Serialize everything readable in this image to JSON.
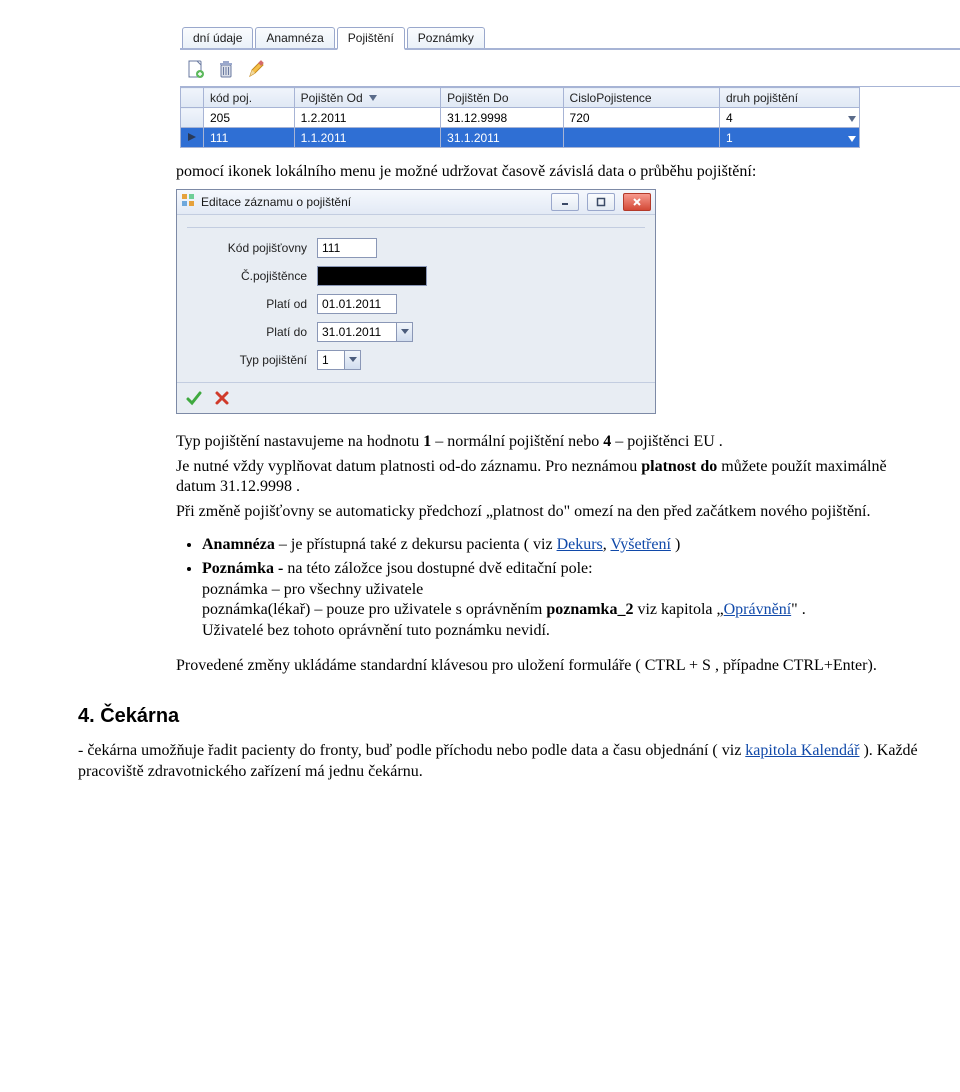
{
  "tabs": {
    "items": [
      "dní údaje",
      "Anamnéza",
      "Pojištění",
      "Poznámky"
    ],
    "active": 2
  },
  "toolbar_icons": [
    "new",
    "delete",
    "edit"
  ],
  "grid": {
    "headers": [
      "kód poj.",
      "Pojištěn Od",
      "Pojištěn Do",
      "CisloPojistence",
      "druh pojištění"
    ],
    "rows": [
      {
        "kod": "205",
        "od": "1.2.2011",
        "do": "31.12.9998",
        "cislo": "720",
        "druh": "4",
        "selected": false
      },
      {
        "kod": "111",
        "od": "1.1.2011",
        "do": "31.1.2011",
        "cislo": "",
        "druh": "1",
        "selected": true
      }
    ]
  },
  "para_intro": "pomocí ikonek lokálního menu je možné udržovat časově závislá data o průběhu pojištění:",
  "dialog": {
    "title": "Editace záznamu o pojištění",
    "fields": {
      "kod_label": "Kód pojišťovny",
      "kod_value": "111",
      "cislo_label": "Č.pojištěnce",
      "cislo_value": "",
      "od_label": "Platí od",
      "od_value": "01.01.2011",
      "do_label": "Platí do",
      "do_value": "31.01.2011",
      "typ_label": "Typ pojištění",
      "typ_value": "1"
    }
  },
  "after_dialog": {
    "p1a": "Typ pojištění nastavujeme na hodnotu ",
    "p1b": "1",
    "p1c": " – normální pojištění nebo ",
    "p1d": "4",
    "p1e": " – pojištěnci EU .",
    "p2a": "Je nutné vždy vyplňovat datum platnosti od-do záznamu. Pro neznámou ",
    "p2b": "platnost do",
    "p2c": " můžete použít maximálně datum 31.12.9998 .",
    "p3": "Při změně pojišťovny se automaticky předchozí „platnost do\" omezí na den před začátkem nového pojištění."
  },
  "bullets": {
    "b1_bold": "Anamnéza",
    "b1_rest1": " –  je přístupná také z dekursu pacienta ( viz ",
    "b1_link1": "Dekurs",
    "b1_comma": ", ",
    "b1_link2": "Vyšetření",
    "b1_rest2": " )",
    "b2_bold": "Poznámka -",
    "b2_rest": "  na této záložce jsou dostupné dvě editační pole:",
    "b2_line1": " poznámka – pro všechny uživatele",
    "b2_line2a": "poznámka(lékař) – pouze pro uživatele s oprávněním ",
    "b2_line2b": "poznamka_2",
    "b2_line2c": "  viz kapitola „",
    "b2_link": "Oprávnění",
    "b2_line2d": "\" .",
    "b2_line3": "Uživatelé bez tohoto oprávnění tuto poznámku nevidí."
  },
  "para_save": "Provedené změny ukládáme standardní klávesou pro uložení formuláře ( CTRL + S , případne CTRL+Enter).",
  "section_heading": "4. Čekárna",
  "section_text": {
    "t1": "- čekárna umožňuje řadit pacienty do fronty, buď podle příchodu nebo podle data a času objednání ( viz ",
    "link1": "kapitola Kalendář",
    "t2": " ). Každé pracoviště zdravotnického zařízení má jednu čekárnu."
  }
}
